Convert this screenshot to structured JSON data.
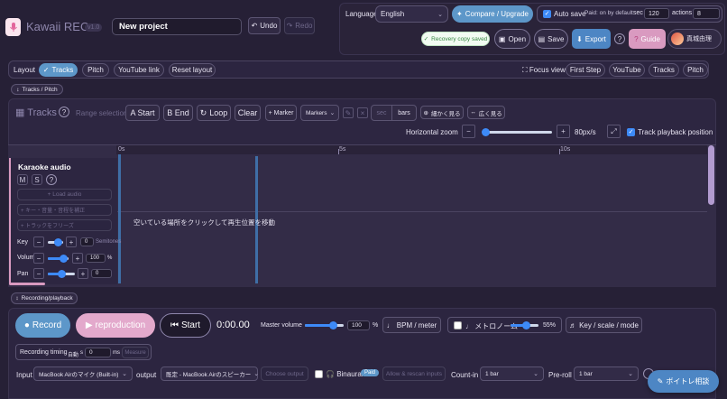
{
  "app": {
    "title": "Kawaii REC",
    "version": "v1.0",
    "project_name": "New project"
  },
  "header": {
    "undo": "Undo",
    "redo": "Redo",
    "language_label": "Language",
    "language_value": "English",
    "compare_upgrade": "Compare / Upgrade",
    "autosave_label": "Auto save",
    "autosave_note": "Paid: on by default",
    "sec_label": "sec",
    "sec_value": "120",
    "actions_label": "actions",
    "actions_value": "8",
    "recovery": "Recovery copy saved",
    "open": "Open",
    "save": "Save",
    "export": "Export",
    "help": "?",
    "guide": "Guide",
    "user_name": "真城由理"
  },
  "layout_bar": {
    "label": "Layout",
    "tabs": [
      "Tracks",
      "Pitch",
      "YouTube link",
      "Reset layout"
    ],
    "focus_view": "Focus view",
    "focus_tabs": [
      "First Step",
      "YouTube",
      "Tracks",
      "Pitch"
    ]
  },
  "tracks_pitch_tag": "Tracks / Pitch",
  "tracks": {
    "title": "Tracks",
    "range_selection": "Range selection",
    "a_start": "A Start",
    "b_end": "B End",
    "loop": "Loop",
    "clear": "Clear",
    "marker": "+ Marker",
    "markers": "Markers",
    "sec": "sec",
    "bars": "bars",
    "zoom_in_jp": "細かく見る",
    "zoom_out_jp": "広く見る",
    "horizontal_zoom": "Horizontal zoom",
    "zoom_value": "80px/s",
    "zoom_fraction": 0.05,
    "track_playback": "Track playback position",
    "ruler": [
      "0s",
      "5s",
      "10s"
    ],
    "hint": "空いている場所をクリックして再生位置を移動"
  },
  "track": {
    "name": "Karaoke audio",
    "m": "M",
    "s": "S",
    "load_audio": "+ Load audio",
    "key_scale": "+ キー・音量・音程を補正",
    "freeze": "+ トラックをフリーズ",
    "key_label": "Key",
    "key_value": "0",
    "key_unit": "Semitones",
    "volume_label": "Volume",
    "volume_value": "100",
    "volume_unit": "%",
    "pan_label": "Pan",
    "pan_value": "0"
  },
  "recording_tag": "Recording/playback",
  "transport": {
    "record": "Record",
    "reproduction": "reproduction",
    "start": "Start",
    "time": "0:00.00",
    "master_volume": "Master volume",
    "master_value": "100",
    "master_unit": "%",
    "bpm_meter": "BPM / meter",
    "metronome": "メトロノーム",
    "metronome_value": "55%",
    "key_scale_mode": "Key / scale / mode"
  },
  "timing": {
    "label": "Recording timing",
    "auto": "自動",
    "s": "s",
    "value": "0",
    "ms": "ms",
    "measure": "Measure"
  },
  "io": {
    "input_label": "Input",
    "input_value": "MacBook Airのマイク (Built-in)",
    "output_label": "output",
    "output_value": "既定 - MacBook Airのスピーカー",
    "choose_output": "Choose output",
    "binaural": "Binaural",
    "paid": "Paid",
    "allow_rescan": "Allow & rescan inputs",
    "countin_label": "Count-in",
    "countin_value": "1 bar",
    "preroll_label": "Pre-roll",
    "preroll_value": "1 bar",
    "consult": "ボイトレ相談"
  }
}
